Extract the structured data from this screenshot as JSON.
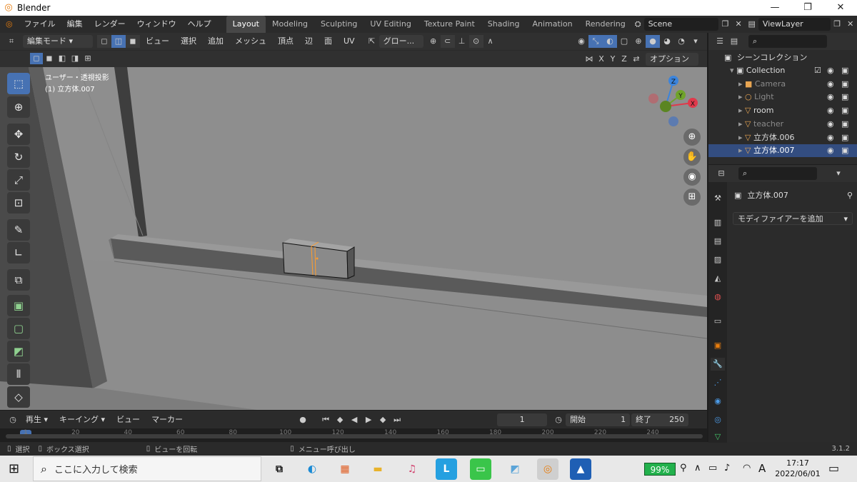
{
  "window": {
    "title": "Blender",
    "minimize": "—",
    "restore": "❐",
    "close": "✕"
  },
  "menubar": {
    "items": [
      "ファイル",
      "編集",
      "レンダー",
      "ウィンドウ",
      "ヘルプ"
    ],
    "workspaces": [
      "Layout",
      "Modeling",
      "Sculpting",
      "UV Editing",
      "Texture Paint",
      "Shading",
      "Animation",
      "Rendering"
    ],
    "scene": "Scene",
    "view_layer": "ViewLayer"
  },
  "viewport_header": {
    "mode": "編集モード",
    "menus": [
      "ビュー",
      "選択",
      "追加",
      "メッシュ",
      "頂点",
      "辺",
      "面",
      "UV"
    ],
    "transform_orientation": "グロー...",
    "options": "オプション",
    "axes": [
      "X",
      "Y",
      "Z"
    ]
  },
  "viewport": {
    "overlay_line1": "ユーザー・透視投影",
    "overlay_line2": "(1) 立方体.007",
    "gizmo_axes": {
      "z": "Z",
      "y": "Y",
      "x": "X"
    }
  },
  "timeline": {
    "menus": [
      "再生",
      "キーイング",
      "ビュー",
      "マーカー"
    ],
    "current_frame": "1",
    "start_label": "開始",
    "start": "1",
    "end_label": "終了",
    "end": "250",
    "ruler_ticks": [
      "1",
      "20",
      "40",
      "60",
      "80",
      "100",
      "120",
      "140",
      "160",
      "180",
      "200",
      "220",
      "240"
    ]
  },
  "statusbar": {
    "items": [
      "選択",
      "ボックス選択",
      "ビューを回転",
      "メニュー呼び出し"
    ],
    "version": "3.1.2"
  },
  "outliner": {
    "title": "シーンコレクション",
    "rows": [
      {
        "name": "Collection",
        "depth": 1,
        "color": "#dddddd",
        "icon": "▣"
      },
      {
        "name": "Camera",
        "depth": 2,
        "color": "#8a8a8a",
        "icon": "■"
      },
      {
        "name": "Light",
        "depth": 2,
        "color": "#8a8a8a",
        "icon": "○"
      },
      {
        "name": "room",
        "depth": 2,
        "color": "#dddddd",
        "icon": "▽"
      },
      {
        "name": "teacher",
        "depth": 2,
        "color": "#8a8a8a",
        "icon": "▽"
      },
      {
        "name": "立方体.006",
        "depth": 2,
        "color": "#dddddd",
        "icon": "▽"
      },
      {
        "name": "立方体.007",
        "depth": 2,
        "color": "#ffffff",
        "icon": "▽",
        "selected": true
      }
    ]
  },
  "properties": {
    "object_name": "立方体.007",
    "add_modifier": "モディファイアーを追加"
  },
  "taskbar": {
    "search_placeholder": "ここに入力して検索",
    "battery": "99%",
    "ime": "A",
    "time": "17:17",
    "date": "2022/06/01"
  },
  "colors": {
    "accent": "#4772b3",
    "orange": "#e87d0d",
    "viewport_bg": "#8e8e8e"
  }
}
